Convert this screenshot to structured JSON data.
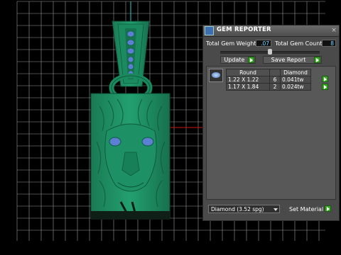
{
  "colors": {
    "model_green": "#1f8a62",
    "grid_line": "#9a9a9a",
    "axis_red": "#d21414",
    "axis_cyan": "#1fd0d0",
    "gem_blue": "#5b7fd1",
    "value_blue": "#7cd6ff",
    "arrow_green": "#3caa28"
  },
  "panel": {
    "title": "GEM REPORTER",
    "title_icon": "gem-reporter-icon",
    "close": "×",
    "total_weight_label": "Total Gem Weight",
    "total_weight_value": ".07",
    "total_count_label": "Total Gem Count",
    "total_count_value": "8",
    "slider_level": 0.5,
    "update_label": "Update",
    "save_report_label": "Save Report",
    "table": {
      "headers": [
        "Round",
        "",
        "Diamond"
      ],
      "rows": [
        {
          "size": "1.22 X 1.22",
          "count": "6",
          "weight": "0.041tw"
        },
        {
          "size": "1.17 X 1.84",
          "count": "2",
          "weight": "0.024tw"
        }
      ]
    },
    "material_value": "Diamond (3.52 spg)",
    "set_material_label": "Set Material"
  }
}
